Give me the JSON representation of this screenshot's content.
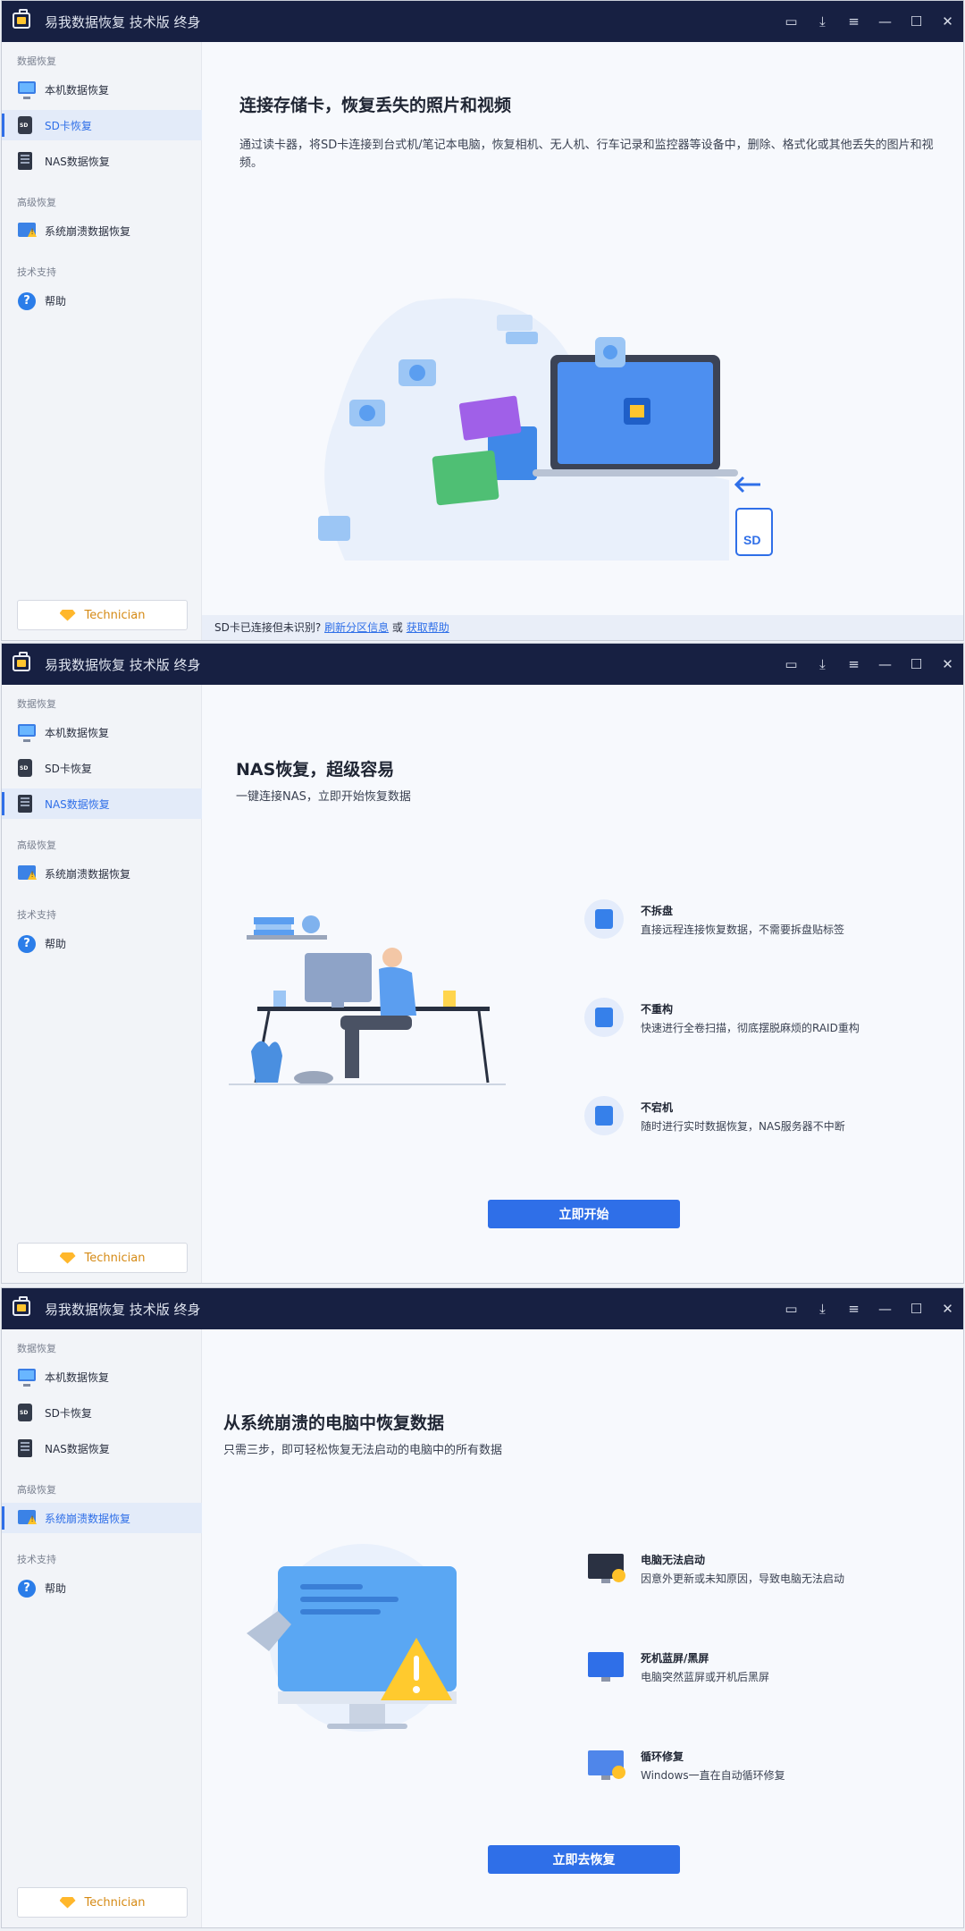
{
  "window": {
    "title": "易我数据恢复 技术版 终身"
  },
  "sidebar": {
    "section_data": "数据恢复",
    "section_advanced": "高级恢复",
    "section_support": "技术支持",
    "items": {
      "local": "本机数据恢复",
      "sd": "SD卡恢复",
      "nas": "NAS数据恢复",
      "crash": "系统崩溃数据恢复",
      "help": "帮助"
    },
    "technician": "Technician"
  },
  "icons": {
    "feedback": "message-icon",
    "download": "download-icon",
    "menu": "menu-icon",
    "minimize": "minimize-icon",
    "maximize": "maximize-icon",
    "close": "close-icon"
  },
  "sd": {
    "title": "连接存储卡，恢复丢失的照片和视频",
    "desc": "通过读卡器，将SD卡连接到台式机/笔记本电脑，恢复相机、无人机、行车记录和监控器等设备中，删除、格式化或其他丢失的图片和视频。",
    "footer_text": "SD卡已连接但未识别?",
    "footer_link1": "刷新分区信息",
    "footer_or": "或",
    "footer_link2": "获取帮助",
    "sd_label": "SD"
  },
  "nas": {
    "title": "NAS恢复，超级容易",
    "subtitle": "一键连接NAS，立即开始恢复数据",
    "features": [
      {
        "title": "不拆盘",
        "desc": "直接远程连接恢复数据，不需要拆盘贴标签"
      },
      {
        "title": "不重构",
        "desc": "快速进行全卷扫描，彻底摆脱麻烦的RAID重构"
      },
      {
        "title": "不宕机",
        "desc": "随时进行实时数据恢复，NAS服务器不中断"
      }
    ],
    "cta": "立即开始"
  },
  "crash": {
    "title": "从系统崩溃的电脑中恢复数据",
    "subtitle": "只需三步，即可轻松恢复无法启动的电脑中的所有数据",
    "features": [
      {
        "title": "电脑无法启动",
        "desc": "因意外更新或未知原因，导致电脑无法启动"
      },
      {
        "title": "死机蓝屏/黑屏",
        "desc": "电脑突然蓝屏或开机后黑屏"
      },
      {
        "title": "循环修复",
        "desc": "Windows一直在自动循环修复"
      }
    ],
    "cta": "立即去恢复"
  },
  "colors": {
    "titlebar": "#172042",
    "accent": "#2f6fe8",
    "sidebar": "#f2f4f8"
  }
}
